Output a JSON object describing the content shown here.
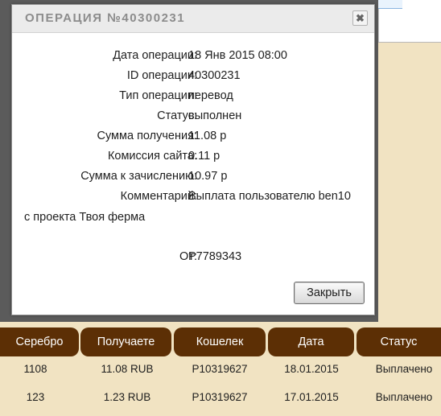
{
  "dialog": {
    "title": "ОПЕРАЦИЯ №40300231",
    "close_symbol": "✖",
    "fields": [
      {
        "label": "Дата операции:",
        "value": "18 Янв 2015 08:00"
      },
      {
        "label": "ID операции:",
        "value": "40300231"
      },
      {
        "label": "Тип операции:",
        "value": "перевод"
      },
      {
        "label": "Статус:",
        "value": "выполнен"
      },
      {
        "label": "Сумма получения:",
        "value": "11.08 р"
      },
      {
        "label": "Комиссия сайта:",
        "value": "0.11 р"
      },
      {
        "label": "Сумма к зачислению:",
        "value": "10.97 р"
      },
      {
        "label": "Комментарий:",
        "value": "Выплата пользователю ben10"
      }
    ],
    "comment_continuation": "с проекта Твоя ферма",
    "from": {
      "label": "От:",
      "value": "P7789343"
    },
    "close_button_label": "Закрыть"
  },
  "table": {
    "headers": [
      "Серебро",
      "Получаете",
      "Кошелек",
      "Дата",
      "Статус"
    ],
    "rows": [
      [
        "1108",
        "11.08 RUB",
        "P10319627",
        "18.01.2015",
        "Выплачено"
      ],
      [
        "123",
        "1.23 RUB",
        "P10319627",
        "17.01.2015",
        "Выплачено"
      ]
    ]
  },
  "colors": {
    "page_background": "#f1e3c2",
    "overlay": "#5b5b5b",
    "table_header": "#5c2f05",
    "title_text": "#8c8c8c"
  },
  "icons": {
    "close": "close-icon"
  }
}
